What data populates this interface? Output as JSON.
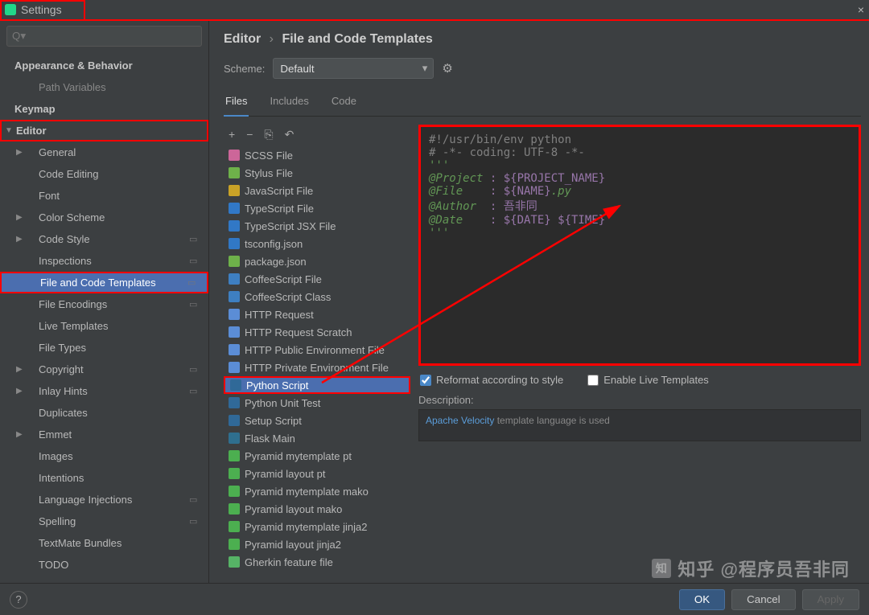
{
  "window": {
    "title": "Settings"
  },
  "search": {
    "placeholder": ""
  },
  "sidebar": {
    "items": [
      {
        "label": "Appearance & Behavior",
        "bold": true
      },
      {
        "label": "Path Variables",
        "sub": true,
        "dim": true
      },
      {
        "label": "Keymap",
        "bold": true
      },
      {
        "label": "Editor",
        "bold": true,
        "tri": "▼",
        "top": true,
        "redbox": true
      },
      {
        "label": "General",
        "tri": "▶",
        "sub2": true
      },
      {
        "label": "Code Editing",
        "sub": true
      },
      {
        "label": "Font",
        "sub": true
      },
      {
        "label": "Color Scheme",
        "tri": "▶",
        "sub2": true
      },
      {
        "label": "Code Style",
        "tri": "▶",
        "sub2": true,
        "dot": true
      },
      {
        "label": "Inspections",
        "sub": true,
        "dot": true
      },
      {
        "label": "File and Code Templates",
        "sub": true,
        "selected": true,
        "redbox": true,
        "dot": true
      },
      {
        "label": "File Encodings",
        "sub": true,
        "dot": true
      },
      {
        "label": "Live Templates",
        "sub": true
      },
      {
        "label": "File Types",
        "sub": true
      },
      {
        "label": "Copyright",
        "tri": "▶",
        "sub2": true,
        "dot": true
      },
      {
        "label": "Inlay Hints",
        "tri": "▶",
        "sub2": true,
        "dot": true
      },
      {
        "label": "Duplicates",
        "sub": true
      },
      {
        "label": "Emmet",
        "tri": "▶",
        "sub2": true
      },
      {
        "label": "Images",
        "sub": true
      },
      {
        "label": "Intentions",
        "sub": true
      },
      {
        "label": "Language Injections",
        "sub": true,
        "dot": true
      },
      {
        "label": "Spelling",
        "sub": true,
        "dot": true
      },
      {
        "label": "TextMate Bundles",
        "sub": true
      },
      {
        "label": "TODO",
        "sub": true
      }
    ]
  },
  "breadcrumb": {
    "a": "Editor",
    "b": "File and Code Templates"
  },
  "scheme": {
    "label": "Scheme:",
    "value": "Default"
  },
  "tabs": [
    "Files",
    "Includes",
    "Code"
  ],
  "toolbar": {
    "add": "+",
    "remove": "−",
    "copy": "⎘",
    "undo": "↶"
  },
  "files": [
    {
      "label": "SCSS File",
      "icon_bg": "#cc6699"
    },
    {
      "label": "Stylus File",
      "icon_bg": "#6eb14a"
    },
    {
      "label": "JavaScript File",
      "icon_bg": "#c9a227"
    },
    {
      "label": "TypeScript File",
      "icon_bg": "#3178c6"
    },
    {
      "label": "TypeScript JSX File",
      "icon_bg": "#3178c6"
    },
    {
      "label": "tsconfig.json",
      "icon_bg": "#3178c6"
    },
    {
      "label": "package.json",
      "icon_bg": "#6eb14a"
    },
    {
      "label": "CoffeeScript File",
      "icon_bg": "#3e7fc1"
    },
    {
      "label": "CoffeeScript Class",
      "icon_bg": "#3e7fc1"
    },
    {
      "label": "HTTP Request",
      "icon_bg": "#5b8dd6"
    },
    {
      "label": "HTTP Request Scratch",
      "icon_bg": "#5b8dd6"
    },
    {
      "label": "HTTP Public Environment File",
      "icon_bg": "#5b8dd6"
    },
    {
      "label": "HTTP Private Environment File",
      "icon_bg": "#5b8dd6"
    },
    {
      "label": "Python Script",
      "icon_bg": "#306998",
      "selected": true,
      "redbox": true
    },
    {
      "label": "Python Unit Test",
      "icon_bg": "#306998"
    },
    {
      "label": "Setup Script",
      "icon_bg": "#306998"
    },
    {
      "label": "Flask Main",
      "icon_bg": "#2f6f8f"
    },
    {
      "label": "Pyramid mytemplate pt",
      "icon_bg": "#4caf50"
    },
    {
      "label": "Pyramid layout pt",
      "icon_bg": "#4caf50"
    },
    {
      "label": "Pyramid mytemplate mako",
      "icon_bg": "#4caf50"
    },
    {
      "label": "Pyramid layout mako",
      "icon_bg": "#4caf50"
    },
    {
      "label": "Pyramid mytemplate jinja2",
      "icon_bg": "#4caf50"
    },
    {
      "label": "Pyramid layout jinja2",
      "icon_bg": "#4caf50"
    },
    {
      "label": "Gherkin feature file",
      "icon_bg": "#56b366"
    }
  ],
  "editor": {
    "l1": "#!/usr/bin/env python",
    "l2": "# -*- coding: UTF-8 -*-",
    "l3": "'''",
    "l4a": "@Project ",
    "l4b": ": ${PROJECT_NAME}",
    "l5a": "@File    ",
    "l5b": ": ${NAME}",
    "l5c": ".py",
    "l6a": "@Author  ",
    "l6b": ": 吾非同",
    "l7a": "@Date    ",
    "l7b": ": ${DATE} ${TIME}",
    "l8": "'''"
  },
  "checks": {
    "reformat": "Reformat according to style",
    "live": "Enable Live Templates"
  },
  "desc": {
    "label": "Description:",
    "link": "Apache Velocity",
    "text": " template language is used"
  },
  "footer": {
    "ok": "OK",
    "cancel": "Cancel",
    "apply": "Apply"
  },
  "watermark": "知乎 @程序员吾非同"
}
